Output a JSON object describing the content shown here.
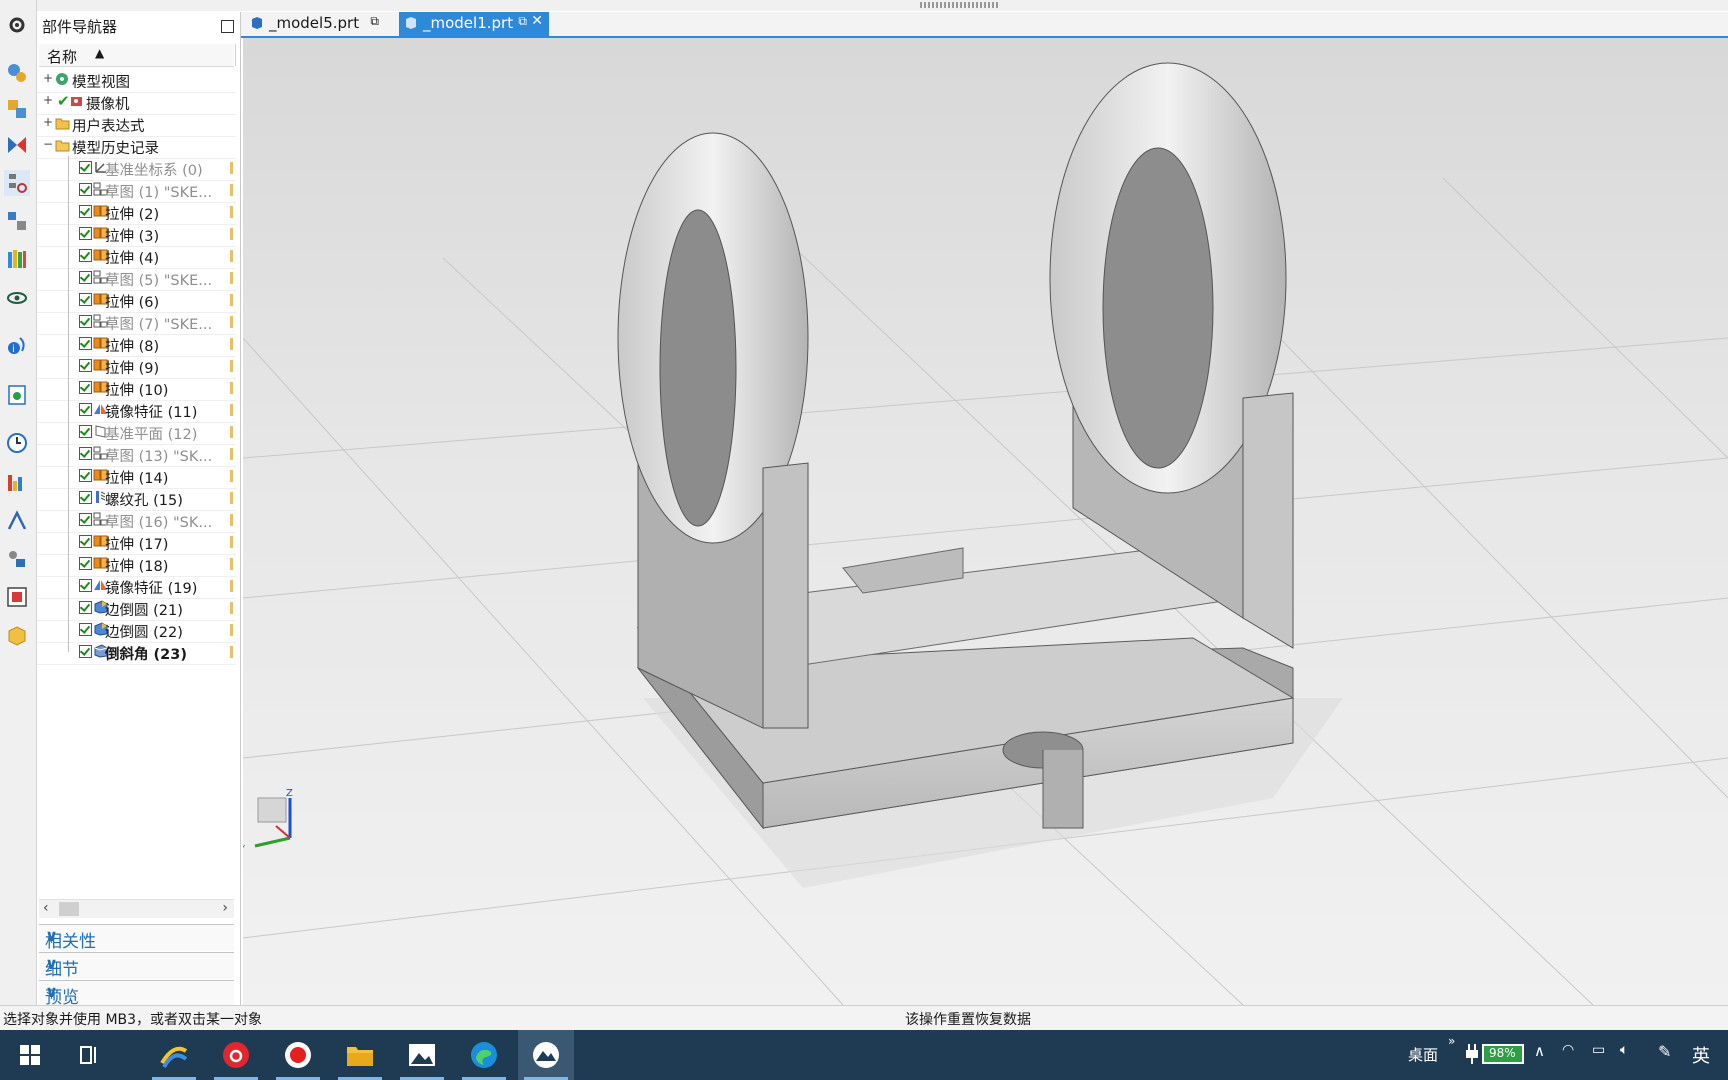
{
  "navigator": {
    "title": "部件导航器",
    "column_name": "名称",
    "tree": [
      {
        "label": "模型视图",
        "level": 0,
        "expander": "+",
        "icon": "model-views-icon"
      },
      {
        "label": "摄像机",
        "level": 0,
        "expander": "+",
        "icon": "camera-icon"
      },
      {
        "label": "用户表达式",
        "level": 0,
        "expander": "+",
        "icon": "folder-icon"
      },
      {
        "label": "模型历史记录",
        "level": 0,
        "expander": "−",
        "icon": "folder-open-icon"
      },
      {
        "label": "基准坐标系 (0)",
        "level": 1,
        "gray": true,
        "icon": "datum-csys-icon"
      },
      {
        "label": "草图 (1) \"SKE...",
        "level": 1,
        "gray": true,
        "icon": "sketch-icon"
      },
      {
        "label": "拉伸 (2)",
        "level": 1,
        "icon": "extrude-icon"
      },
      {
        "label": "拉伸 (3)",
        "level": 1,
        "icon": "extrude-icon"
      },
      {
        "label": "拉伸 (4)",
        "level": 1,
        "icon": "extrude-icon"
      },
      {
        "label": "草图 (5) \"SKE...",
        "level": 1,
        "gray": true,
        "icon": "sketch-icon"
      },
      {
        "label": "拉伸 (6)",
        "level": 1,
        "icon": "extrude-icon"
      },
      {
        "label": "草图 (7) \"SKE...",
        "level": 1,
        "gray": true,
        "icon": "sketch-icon"
      },
      {
        "label": "拉伸 (8)",
        "level": 1,
        "icon": "extrude-icon"
      },
      {
        "label": "拉伸 (9)",
        "level": 1,
        "icon": "extrude-icon"
      },
      {
        "label": "拉伸 (10)",
        "level": 1,
        "icon": "extrude-icon"
      },
      {
        "label": "镜像特征 (11)",
        "level": 1,
        "icon": "mirror-feature-icon"
      },
      {
        "label": "基准平面 (12)",
        "level": 1,
        "gray": true,
        "icon": "datum-plane-icon"
      },
      {
        "label": "草图 (13) \"SK...",
        "level": 1,
        "gray": true,
        "icon": "sketch-icon"
      },
      {
        "label": "拉伸 (14)",
        "level": 1,
        "icon": "extrude-icon"
      },
      {
        "label": "螺纹孔 (15)",
        "level": 1,
        "icon": "threaded-hole-icon"
      },
      {
        "label": "草图 (16) \"SK...",
        "level": 1,
        "gray": true,
        "icon": "sketch-icon"
      },
      {
        "label": "拉伸 (17)",
        "level": 1,
        "icon": "extrude-icon"
      },
      {
        "label": "拉伸 (18)",
        "level": 1,
        "icon": "extrude-icon"
      },
      {
        "label": "镜像特征 (19)",
        "level": 1,
        "icon": "mirror-feature-icon"
      },
      {
        "label": "边倒圆 (21)",
        "level": 1,
        "icon": "edge-blend-icon"
      },
      {
        "label": "边倒圆 (22)",
        "level": 1,
        "icon": "edge-blend-icon"
      },
      {
        "label": "倒斜角 (23)",
        "level": 1,
        "bold": true,
        "icon": "chamfer-icon"
      }
    ],
    "panels": [
      "相关性",
      "细节",
      "预览"
    ]
  },
  "tabs": [
    {
      "label": "_model5.prt",
      "active": false
    },
    {
      "label": "_model1.prt",
      "active": true
    }
  ],
  "viewport": {
    "axis_labels": {
      "z": "Z",
      "y": "Y"
    }
  },
  "status": {
    "left": "选择对象并使用 MB3，或者双击某一对象",
    "center": "该操作重置恢复数据"
  },
  "taskbar": {
    "desktop_label": "桌面",
    "battery": "98%",
    "ime": "英",
    "apps": [
      "start-icon",
      "task-view-icon",
      "app-icon",
      "netease-music-icon",
      "recorder-icon",
      "file-explorer-icon",
      "photos-icon",
      "edge-icon",
      "nx-icon"
    ]
  }
}
